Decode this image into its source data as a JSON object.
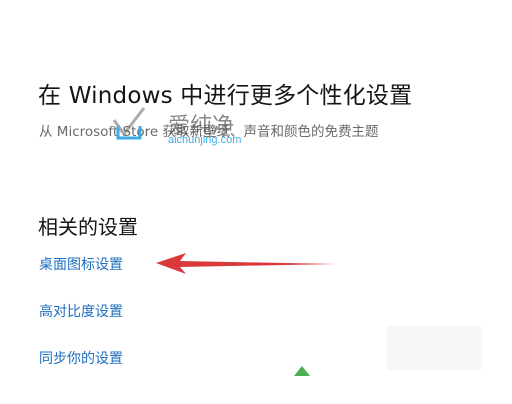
{
  "personalize": {
    "heading": "在 Windows 中进行更多个性化设置",
    "subtext": "从 Microsoft Store 获取新壁纸、声音和颜色的免费主题"
  },
  "related": {
    "title": "相关的设置",
    "links": [
      "桌面图标设置",
      "高对比度设置",
      "同步你的设置"
    ]
  },
  "watermark": {
    "text_cn": "爱纯净",
    "url": "aichunjing.com"
  },
  "colors": {
    "link": "#1e6fbf",
    "arrow": "#d9393b",
    "watermark_url": "#2aa3e6"
  },
  "icons": {
    "annotation_arrow": "red-arrow-icon",
    "watermark_logo": "aichunjing-logo-icon",
    "corner_mark": "green-triangle-icon"
  }
}
